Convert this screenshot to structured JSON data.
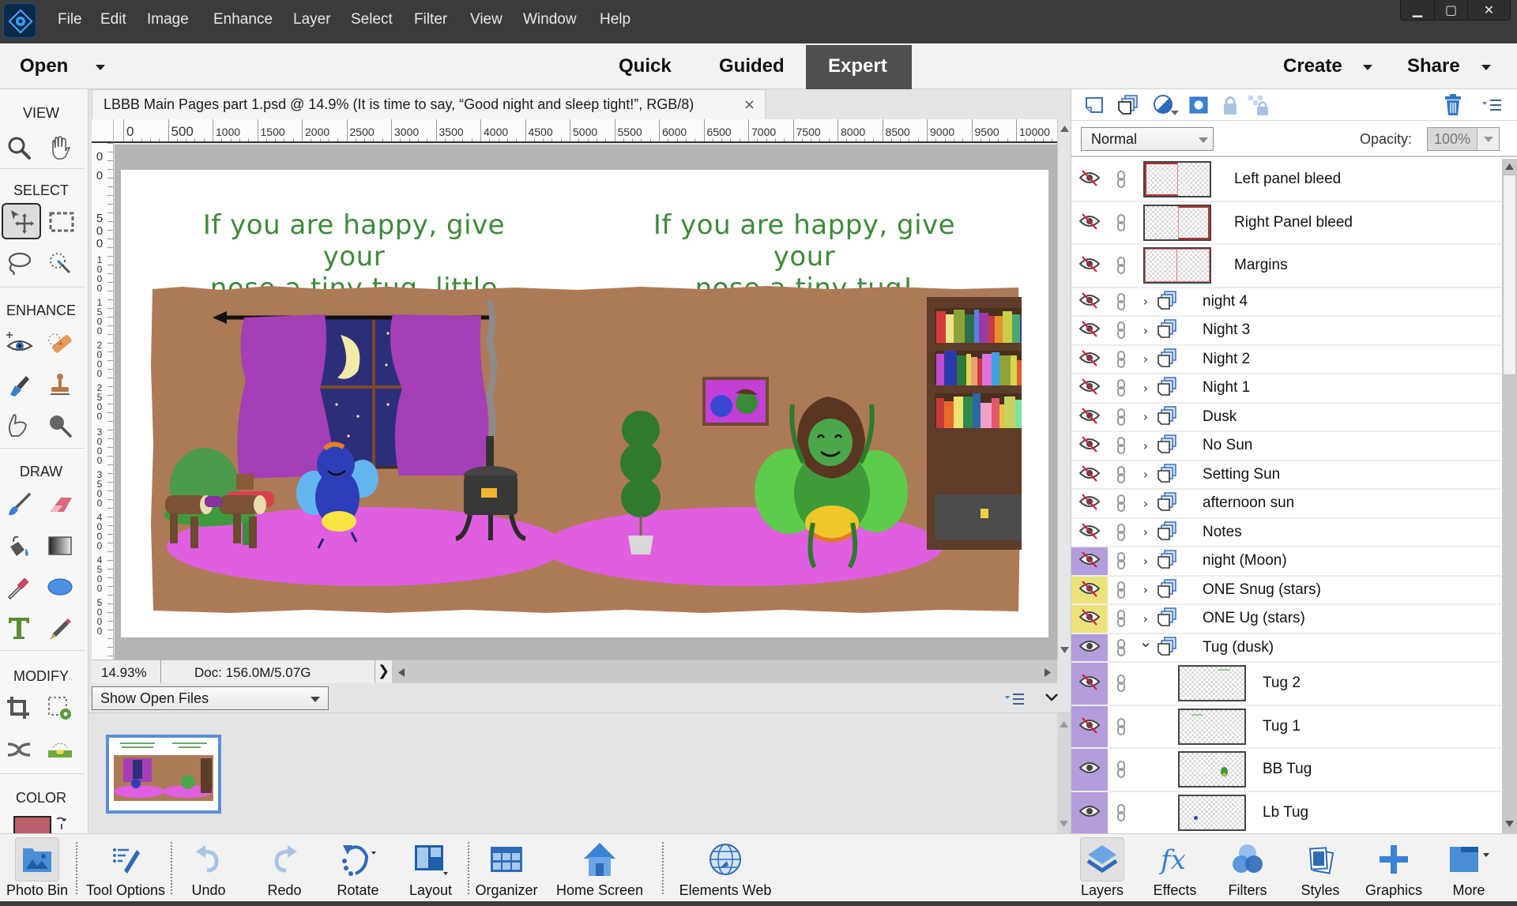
{
  "menubar": {
    "items": [
      "File",
      "Edit",
      "Image",
      "Enhance",
      "Layer",
      "Select",
      "Filter",
      "View",
      "Window",
      "Help"
    ],
    "window_controls": {
      "minimize": "▁",
      "maximize": "▢",
      "close": "✕"
    }
  },
  "modebar": {
    "open_label": "Open",
    "modes": [
      {
        "label": "Quick",
        "active": false
      },
      {
        "label": "Guided",
        "active": false
      },
      {
        "label": "Expert",
        "active": true
      }
    ],
    "create_label": "Create",
    "share_label": "Share"
  },
  "toolbox": {
    "sections": {
      "view": "VIEW",
      "select": "SELECT",
      "enhance": "ENHANCE",
      "draw": "DRAW",
      "modify": "MODIFY",
      "color": "COLOR"
    },
    "tools": [
      {
        "name": "zoom-tool",
        "icon": "magnifier-icon"
      },
      {
        "name": "hand-tool",
        "icon": "hand-icon"
      },
      {
        "name": "move-tool",
        "icon": "move-arrow-icon",
        "active": true
      },
      {
        "name": "rectangular-marquee-tool",
        "icon": "marquee-icon"
      },
      {
        "name": "lasso-tool",
        "icon": "lasso-icon"
      },
      {
        "name": "quick-selection-tool",
        "icon": "magic-wand-icon"
      },
      {
        "name": "red-eye-tool",
        "icon": "eye-icon"
      },
      {
        "name": "spot-healing-tool",
        "icon": "bandage-icon"
      },
      {
        "name": "smart-brush-tool",
        "icon": "smart-brush-icon"
      },
      {
        "name": "clone-stamp-tool",
        "icon": "stamp-icon"
      },
      {
        "name": "smudge-tool",
        "icon": "finger-icon"
      },
      {
        "name": "sponge-tool",
        "icon": "sponge-icon"
      },
      {
        "name": "brush-tool",
        "icon": "brush-icon"
      },
      {
        "name": "eraser-tool",
        "icon": "eraser-icon"
      },
      {
        "name": "paint-bucket-tool",
        "icon": "bucket-icon"
      },
      {
        "name": "gradient-tool",
        "icon": "gradient-icon"
      },
      {
        "name": "eyedropper-tool",
        "icon": "eyedropper-icon"
      },
      {
        "name": "ellipse-tool",
        "icon": "ellipse-icon"
      },
      {
        "name": "type-tool",
        "icon": "type-icon"
      },
      {
        "name": "pencil-tool",
        "icon": "pencil-icon"
      },
      {
        "name": "crop-tool",
        "icon": "crop-icon"
      },
      {
        "name": "recompose-tool",
        "icon": "recompose-icon"
      },
      {
        "name": "content-aware-move-tool",
        "icon": "shuffle-icon"
      },
      {
        "name": "straighten-tool",
        "icon": "level-icon"
      }
    ],
    "foreground_color": "#b9606b"
  },
  "document": {
    "tab_title": "LBBB Main Pages part 1.psd @ 14.9% (It is time to say,  “Good night and sleep tight!”, RGB/8)",
    "close_glyph": "×",
    "ruler_top_labels": [
      "0",
      "500",
      "1000",
      "1500",
      "2000",
      "2500",
      "3000",
      "3500",
      "4000",
      "4500",
      "5000",
      "5500",
      "6000",
      "6500",
      "7000",
      "7500",
      "8000",
      "8500",
      "9000",
      "9500",
      "10000"
    ],
    "ruler_left_labels": [
      "0",
      "0",
      "500",
      "1000",
      "1500",
      "2000",
      "2500",
      "3000",
      "3500",
      "4000",
      "4500",
      "5000"
    ],
    "left_page_text": [
      "If you are happy, give your",
      "nose a tiny tug, little bug..."
    ],
    "right_page_text": [
      "If you are happy, give your",
      "nose a tiny tug!"
    ],
    "zoom_percent": "14.93%",
    "doc_size": "Doc: 156.0M/5.07G",
    "status_arrow": "❯"
  },
  "photo_bin": {
    "show_select": "Show Open Files"
  },
  "layers_panel": {
    "blend_mode": "Normal",
    "opacity_label": "Opacity:",
    "opacity_value": "100%",
    "layers": [
      {
        "name": "Left panel bleed",
        "type": "layer",
        "visible": false,
        "thumb": "left-bleed"
      },
      {
        "name": "Right Panel bleed",
        "type": "layer",
        "visible": false,
        "thumb": "right-bleed"
      },
      {
        "name": "Margins",
        "type": "layer",
        "visible": false,
        "thumb": "margins"
      },
      {
        "name": "night 4",
        "type": "group",
        "visible": false,
        "expanded": false,
        "tag": "none"
      },
      {
        "name": "Night 3",
        "type": "group",
        "visible": false,
        "expanded": false,
        "tag": "none"
      },
      {
        "name": "Night 2",
        "type": "group",
        "visible": false,
        "expanded": false,
        "tag": "none"
      },
      {
        "name": "Night 1",
        "type": "group",
        "visible": false,
        "expanded": false,
        "tag": "none"
      },
      {
        "name": "Dusk",
        "type": "group",
        "visible": false,
        "expanded": false,
        "tag": "none"
      },
      {
        "name": "No Sun",
        "type": "group",
        "visible": false,
        "expanded": false,
        "tag": "none"
      },
      {
        "name": "Setting Sun",
        "type": "group",
        "visible": false,
        "expanded": false,
        "tag": "none"
      },
      {
        "name": "afternoon sun",
        "type": "group",
        "visible": false,
        "expanded": false,
        "tag": "none"
      },
      {
        "name": "Notes",
        "type": "group",
        "visible": false,
        "expanded": false,
        "tag": "none"
      },
      {
        "name": "night (Moon)",
        "type": "group",
        "visible": false,
        "expanded": false,
        "tag": "violet"
      },
      {
        "name": "ONE Snug (stars)",
        "type": "group",
        "visible": false,
        "expanded": false,
        "tag": "yellow"
      },
      {
        "name": "ONE Ug (stars)",
        "type": "group",
        "visible": false,
        "expanded": false,
        "tag": "yellow"
      },
      {
        "name": "Tug (dusk)",
        "type": "group",
        "visible": true,
        "expanded": true,
        "tag": "violet"
      },
      {
        "name": "Tug 2",
        "type": "child",
        "visible": false,
        "tag": "violet",
        "thumb": "text-top-right"
      },
      {
        "name": "Tug 1",
        "type": "child",
        "visible": false,
        "tag": "violet",
        "thumb": "text-top-left"
      },
      {
        "name": "BB Tug",
        "type": "child",
        "visible": true,
        "tag": "violet",
        "thumb": "green-bug"
      },
      {
        "name": "Lb Tug",
        "type": "child",
        "visible": true,
        "tag": "violet",
        "thumb": "blue-bug"
      }
    ],
    "tag_colors": {
      "violet": "#b39ddb",
      "yellow": "#ece27c",
      "none": "#ffffff"
    }
  },
  "bottombar": {
    "left": [
      {
        "label": "Photo Bin",
        "icon": "photo-bin-icon",
        "active": true
      },
      {
        "label": "Tool Options",
        "icon": "tool-options-icon"
      },
      {
        "label": "Undo",
        "icon": "undo-icon"
      },
      {
        "label": "Redo",
        "icon": "redo-icon"
      },
      {
        "label": "Rotate",
        "icon": "rotate-icon"
      },
      {
        "label": "Layout",
        "icon": "layout-icon"
      },
      {
        "label": "Organizer",
        "icon": "organizer-icon"
      },
      {
        "label": "Home Screen",
        "icon": "home-icon"
      },
      {
        "label": "Elements Web",
        "icon": "globe-icon"
      }
    ],
    "right": [
      {
        "label": "Layers",
        "icon": "layers-icon",
        "active": true
      },
      {
        "label": "Effects",
        "icon": "fx-icon"
      },
      {
        "label": "Filters",
        "icon": "filters-icon"
      },
      {
        "label": "Styles",
        "icon": "styles-icon"
      },
      {
        "label": "Graphics",
        "icon": "graphics-plus-icon"
      },
      {
        "label": "More",
        "icon": "more-panel-icon"
      }
    ]
  }
}
